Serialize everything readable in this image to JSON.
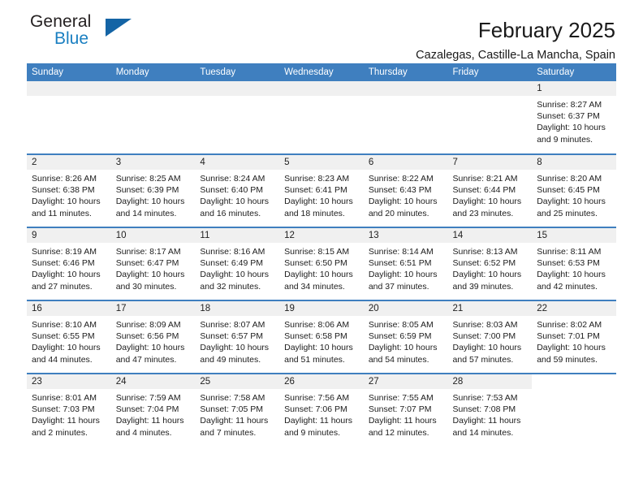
{
  "brand": {
    "word1": "General",
    "word2": "Blue",
    "triangle_color": "#1464a5",
    "blue_text_color": "#1a7fc1"
  },
  "header": {
    "title": "February 2025",
    "subtitle": "Cazalegas, Castille-La Mancha, Spain",
    "header_bg": "#3f7fbf",
    "daynum_bg": "#f0f0f0"
  },
  "weekdays": [
    "Sunday",
    "Monday",
    "Tuesday",
    "Wednesday",
    "Thursday",
    "Friday",
    "Saturday"
  ],
  "labels": {
    "sunrise": "Sunrise:",
    "sunset": "Sunset:",
    "daylight": "Daylight:"
  },
  "weeks": [
    [
      {
        "day": "",
        "sunrise": "",
        "sunset": "",
        "daylight": "",
        "band": true
      },
      {
        "day": "",
        "sunrise": "",
        "sunset": "",
        "daylight": "",
        "band": true
      },
      {
        "day": "",
        "sunrise": "",
        "sunset": "",
        "daylight": "",
        "band": true
      },
      {
        "day": "",
        "sunrise": "",
        "sunset": "",
        "daylight": "",
        "band": true
      },
      {
        "day": "",
        "sunrise": "",
        "sunset": "",
        "daylight": "",
        "band": true
      },
      {
        "day": "",
        "sunrise": "",
        "sunset": "",
        "daylight": "",
        "band": true
      },
      {
        "day": "1",
        "sunrise": "Sunrise: 8:27 AM",
        "sunset": "Sunset: 6:37 PM",
        "daylight": "Daylight: 10 hours and 9 minutes.",
        "band": true
      }
    ],
    [
      {
        "day": "2",
        "sunrise": "Sunrise: 8:26 AM",
        "sunset": "Sunset: 6:38 PM",
        "daylight": "Daylight: 10 hours and 11 minutes.",
        "band": true
      },
      {
        "day": "3",
        "sunrise": "Sunrise: 8:25 AM",
        "sunset": "Sunset: 6:39 PM",
        "daylight": "Daylight: 10 hours and 14 minutes.",
        "band": true
      },
      {
        "day": "4",
        "sunrise": "Sunrise: 8:24 AM",
        "sunset": "Sunset: 6:40 PM",
        "daylight": "Daylight: 10 hours and 16 minutes.",
        "band": true
      },
      {
        "day": "5",
        "sunrise": "Sunrise: 8:23 AM",
        "sunset": "Sunset: 6:41 PM",
        "daylight": "Daylight: 10 hours and 18 minutes.",
        "band": true
      },
      {
        "day": "6",
        "sunrise": "Sunrise: 8:22 AM",
        "sunset": "Sunset: 6:43 PM",
        "daylight": "Daylight: 10 hours and 20 minutes.",
        "band": true
      },
      {
        "day": "7",
        "sunrise": "Sunrise: 8:21 AM",
        "sunset": "Sunset: 6:44 PM",
        "daylight": "Daylight: 10 hours and 23 minutes.",
        "band": true
      },
      {
        "day": "8",
        "sunrise": "Sunrise: 8:20 AM",
        "sunset": "Sunset: 6:45 PM",
        "daylight": "Daylight: 10 hours and 25 minutes.",
        "band": true
      }
    ],
    [
      {
        "day": "9",
        "sunrise": "Sunrise: 8:19 AM",
        "sunset": "Sunset: 6:46 PM",
        "daylight": "Daylight: 10 hours and 27 minutes.",
        "band": true
      },
      {
        "day": "10",
        "sunrise": "Sunrise: 8:17 AM",
        "sunset": "Sunset: 6:47 PM",
        "daylight": "Daylight: 10 hours and 30 minutes.",
        "band": true
      },
      {
        "day": "11",
        "sunrise": "Sunrise: 8:16 AM",
        "sunset": "Sunset: 6:49 PM",
        "daylight": "Daylight: 10 hours and 32 minutes.",
        "band": true
      },
      {
        "day": "12",
        "sunrise": "Sunrise: 8:15 AM",
        "sunset": "Sunset: 6:50 PM",
        "daylight": "Daylight: 10 hours and 34 minutes.",
        "band": true
      },
      {
        "day": "13",
        "sunrise": "Sunrise: 8:14 AM",
        "sunset": "Sunset: 6:51 PM",
        "daylight": "Daylight: 10 hours and 37 minutes.",
        "band": true
      },
      {
        "day": "14",
        "sunrise": "Sunrise: 8:13 AM",
        "sunset": "Sunset: 6:52 PM",
        "daylight": "Daylight: 10 hours and 39 minutes.",
        "band": true
      },
      {
        "day": "15",
        "sunrise": "Sunrise: 8:11 AM",
        "sunset": "Sunset: 6:53 PM",
        "daylight": "Daylight: 10 hours and 42 minutes.",
        "band": true
      }
    ],
    [
      {
        "day": "16",
        "sunrise": "Sunrise: 8:10 AM",
        "sunset": "Sunset: 6:55 PM",
        "daylight": "Daylight: 10 hours and 44 minutes.",
        "band": true
      },
      {
        "day": "17",
        "sunrise": "Sunrise: 8:09 AM",
        "sunset": "Sunset: 6:56 PM",
        "daylight": "Daylight: 10 hours and 47 minutes.",
        "band": true
      },
      {
        "day": "18",
        "sunrise": "Sunrise: 8:07 AM",
        "sunset": "Sunset: 6:57 PM",
        "daylight": "Daylight: 10 hours and 49 minutes.",
        "band": true
      },
      {
        "day": "19",
        "sunrise": "Sunrise: 8:06 AM",
        "sunset": "Sunset: 6:58 PM",
        "daylight": "Daylight: 10 hours and 51 minutes.",
        "band": true
      },
      {
        "day": "20",
        "sunrise": "Sunrise: 8:05 AM",
        "sunset": "Sunset: 6:59 PM",
        "daylight": "Daylight: 10 hours and 54 minutes.",
        "band": true
      },
      {
        "day": "21",
        "sunrise": "Sunrise: 8:03 AM",
        "sunset": "Sunset: 7:00 PM",
        "daylight": "Daylight: 10 hours and 57 minutes.",
        "band": true
      },
      {
        "day": "22",
        "sunrise": "Sunrise: 8:02 AM",
        "sunset": "Sunset: 7:01 PM",
        "daylight": "Daylight: 10 hours and 59 minutes.",
        "band": true
      }
    ],
    [
      {
        "day": "23",
        "sunrise": "Sunrise: 8:01 AM",
        "sunset": "Sunset: 7:03 PM",
        "daylight": "Daylight: 11 hours and 2 minutes.",
        "band": true
      },
      {
        "day": "24",
        "sunrise": "Sunrise: 7:59 AM",
        "sunset": "Sunset: 7:04 PM",
        "daylight": "Daylight: 11 hours and 4 minutes.",
        "band": true
      },
      {
        "day": "25",
        "sunrise": "Sunrise: 7:58 AM",
        "sunset": "Sunset: 7:05 PM",
        "daylight": "Daylight: 11 hours and 7 minutes.",
        "band": true
      },
      {
        "day": "26",
        "sunrise": "Sunrise: 7:56 AM",
        "sunset": "Sunset: 7:06 PM",
        "daylight": "Daylight: 11 hours and 9 minutes.",
        "band": true
      },
      {
        "day": "27",
        "sunrise": "Sunrise: 7:55 AM",
        "sunset": "Sunset: 7:07 PM",
        "daylight": "Daylight: 11 hours and 12 minutes.",
        "band": true
      },
      {
        "day": "28",
        "sunrise": "Sunrise: 7:53 AM",
        "sunset": "Sunset: 7:08 PM",
        "daylight": "Daylight: 11 hours and 14 minutes.",
        "band": true
      },
      {
        "day": "",
        "sunrise": "",
        "sunset": "",
        "daylight": "",
        "band": false
      }
    ]
  ]
}
